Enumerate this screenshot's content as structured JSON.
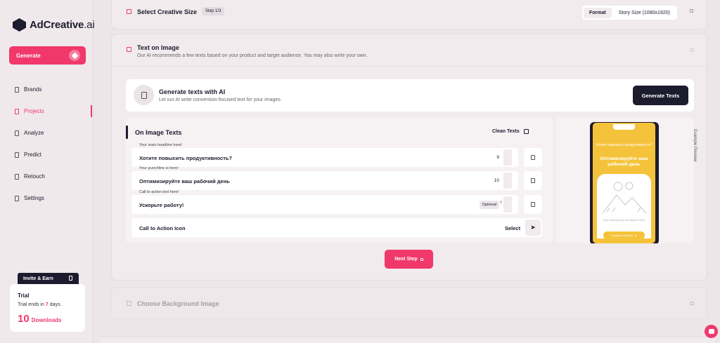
{
  "brand": {
    "name": "AdCreative",
    "suffix": ".ai"
  },
  "sidebar": {
    "generate_label": "Generate",
    "items": [
      {
        "label": "Brands",
        "icon": "tag-icon"
      },
      {
        "label": "Projects",
        "icon": "folder-icon",
        "active": true
      },
      {
        "label": "Analyze",
        "icon": "chart-icon"
      },
      {
        "label": "Predict",
        "icon": "target-icon"
      },
      {
        "label": "Retouch",
        "icon": "wand-icon"
      },
      {
        "label": "Settings",
        "icon": "gear-icon"
      }
    ],
    "invite_label": "Invite & Earn",
    "trial": {
      "title": "Trial",
      "ends_prefix": "Trial ends in",
      "days": "7",
      "days_suffix": "days.",
      "downloads_count": "10",
      "downloads_label": "Downloads"
    }
  },
  "step1": {
    "title": "Select Creative Size",
    "badge": "Step 1/3",
    "format_label": "Format",
    "size_label": "Story Size (1080x1920)"
  },
  "step2": {
    "title": "Text on Image",
    "subtitle": "Our AI recommends a few texts based on your product and target audience. You may also write your own.",
    "generate_box": {
      "title": "Generate texts with AI",
      "subtitle": "Let our AI write conversion-focused text for your images.",
      "button": "Generate Texts"
    },
    "on_image": {
      "title": "On Image Texts",
      "clean_label": "Clean Texts",
      "fields": [
        {
          "label": "Your main headline here!",
          "value": "Хотите повысить продуктивность?",
          "count": "9"
        },
        {
          "label": "Your punchline is here!",
          "value": "Оптимизируйте ваш рабочий день",
          "count": "10"
        },
        {
          "label": "Call to action text here!",
          "value": "Ускорьте работу!",
          "optional": "Optional",
          "help": "?"
        }
      ],
      "cta_icon": {
        "label": "Call to Action Icon",
        "select": "Select"
      }
    },
    "preview": {
      "label": "Example Preview",
      "small_text": "Хотите повысить продуктивность?",
      "big_text": "Оптимизируйте ваш рабочий день",
      "image_caption": "Your background will appear here",
      "button_text": "Ускорьте работу!"
    },
    "next_label": "Next Step"
  },
  "step3": {
    "title": "Choose Background Image"
  },
  "colors": {
    "accent": "#f0386b",
    "dark": "#1d1b2e",
    "preview_bg": "#f5c33b"
  }
}
